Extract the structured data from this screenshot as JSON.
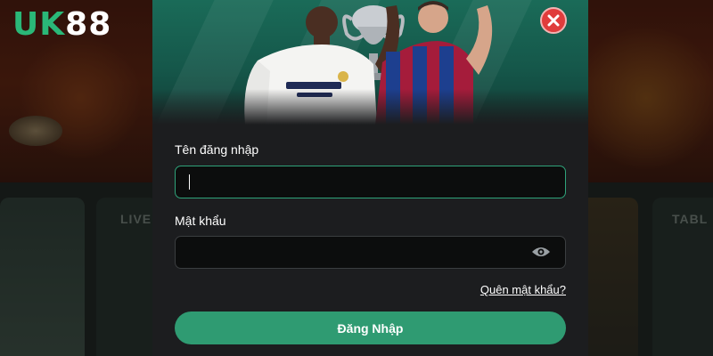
{
  "background": {
    "logo": {
      "letters": "UK",
      "digits": "88"
    },
    "section_labels": [
      "LIVE",
      "TABL"
    ]
  },
  "login_modal": {
    "close_icon": "close-icon",
    "username": {
      "label": "Tên đăng nhập",
      "value": "",
      "placeholder": ""
    },
    "password": {
      "label": "Mật khẩu",
      "value": "",
      "placeholder": "",
      "toggle_icon": "eye-icon"
    },
    "forgot_password_link": "Quên mật khẩu?",
    "submit_label": "Đăng Nhập"
  },
  "colors": {
    "accent": "#2f9b72",
    "focus_border": "#2fa37a",
    "close": "#e03c3c",
    "modal_bg": "#1c1d1f",
    "input_bg": "#0c0d0d"
  }
}
